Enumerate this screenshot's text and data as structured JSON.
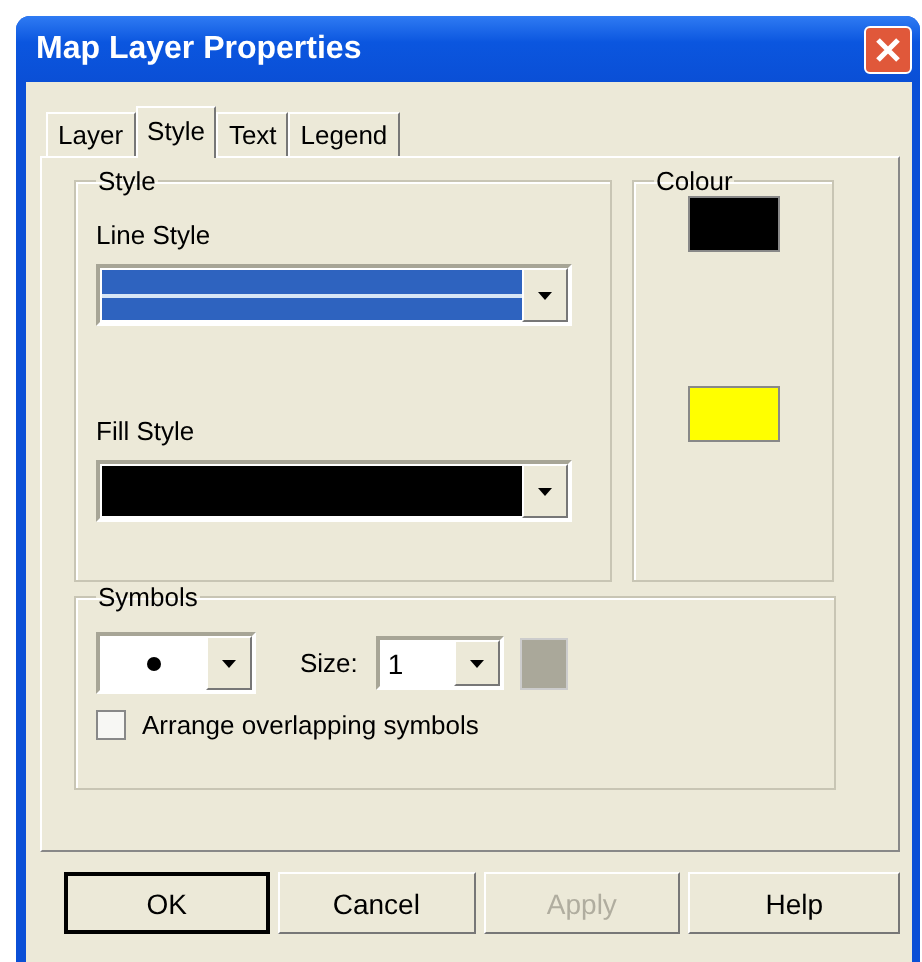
{
  "window": {
    "title": "Map Layer Properties"
  },
  "tabs": [
    {
      "label": "Layer",
      "selected": false
    },
    {
      "label": "Style",
      "selected": true
    },
    {
      "label": "Text",
      "selected": false
    },
    {
      "label": "Legend",
      "selected": false
    }
  ],
  "style_group": {
    "title": "Style",
    "fields": [
      {
        "label": "Line Style",
        "kind": "line"
      },
      {
        "label": "Fill Style",
        "kind": "fill"
      }
    ]
  },
  "colour_group": {
    "title": "Colour",
    "swatches": [
      {
        "color": "#000000"
      },
      {
        "color": "#ffff00"
      }
    ]
  },
  "symbols_group": {
    "title": "Symbols",
    "size_label": "Size:",
    "size_value": "1",
    "checkbox": {
      "label": "Arrange overlapping symbols",
      "checked": false
    }
  },
  "buttons": [
    {
      "label": "OK",
      "default": true,
      "disabled": false
    },
    {
      "label": "Cancel",
      "default": false,
      "disabled": false
    },
    {
      "label": "Apply",
      "default": false,
      "disabled": true
    },
    {
      "label": "Help",
      "default": false,
      "disabled": false
    }
  ]
}
